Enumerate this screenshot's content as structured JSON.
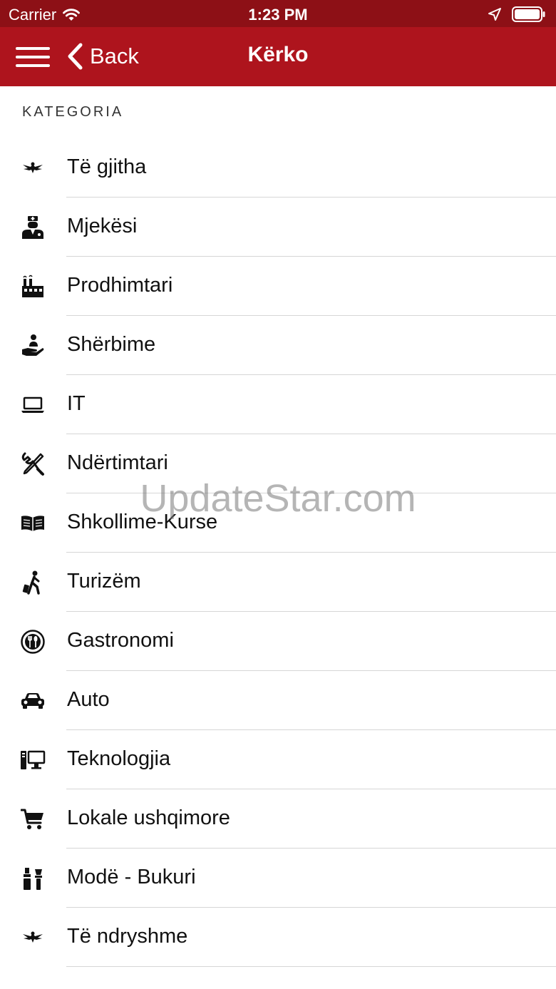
{
  "status_bar": {
    "carrier": "Carrier",
    "time": "1:23 PM"
  },
  "nav": {
    "back_label": "Back",
    "title": "Kërko"
  },
  "section_header": "KATEGORIA",
  "categories": [
    {
      "label": "Të gjitha",
      "icon": "eagle-icon"
    },
    {
      "label": "Mjekësi",
      "icon": "doctor-icon"
    },
    {
      "label": "Prodhimtari",
      "icon": "factory-icon"
    },
    {
      "label": "Shërbime",
      "icon": "service-hand-icon"
    },
    {
      "label": "IT",
      "icon": "laptop-icon"
    },
    {
      "label": "Ndërtimtari",
      "icon": "tools-icon"
    },
    {
      "label": "Shkollime-Kurse",
      "icon": "book-icon"
    },
    {
      "label": "Turizëm",
      "icon": "traveler-icon"
    },
    {
      "label": "Gastronomi",
      "icon": "plate-cutlery-icon"
    },
    {
      "label": "Auto",
      "icon": "car-icon"
    },
    {
      "label": "Teknologjia",
      "icon": "desktop-computer-icon"
    },
    {
      "label": "Lokale ushqimore",
      "icon": "shopping-cart-icon"
    },
    {
      "label": "Modë - Bukuri",
      "icon": "cosmetics-icon"
    },
    {
      "label": "Të ndryshme",
      "icon": "eagle-icon"
    }
  ],
  "watermark": "UpdateStar.com",
  "colors": {
    "status_bar": "#8d1016",
    "nav_bar": "#ae141d",
    "divider": "#d6d6d6"
  }
}
